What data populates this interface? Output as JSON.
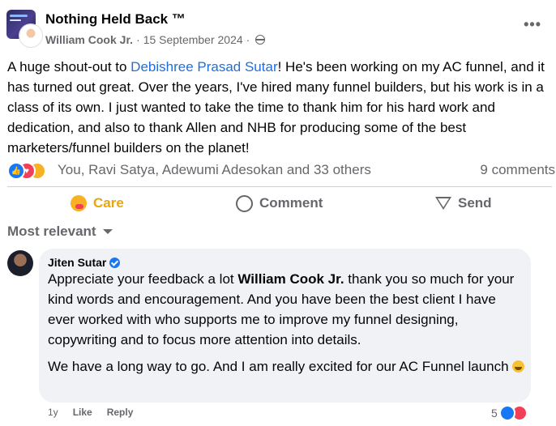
{
  "post": {
    "group_name": "Nothing Held Back ™",
    "author": "William Cook Jr.",
    "separator": " · ",
    "date": "15 September 2024",
    "text_before": "A huge shout-out to ",
    "mention": "Debishree Prasad Sutar",
    "text_after": "! He's been working on my AC funnel, and it has turned out great. Over the years, I've hired many funnel builders, but his work is in a class of its own. I just wanted to take the time to thank him for his hard work and dedication, and also to thank Allen and NHB for producing some of the best marketers/funnel builders on the planet!",
    "reaction_names": "You, Ravi Satya, Adewumi Adesokan and 33 others",
    "comments_count": "9 comments"
  },
  "actions": {
    "care": "Care",
    "comment": "Comment",
    "send": "Send"
  },
  "sort_label": "Most relevant",
  "comment": {
    "author": "Jiten Sutar",
    "p1_before": "Appreciate your feedback a lot ",
    "p1_bold": "William Cook Jr.",
    "p1_after": " thank you so much for your kind words and encouragement. And you have been the best client I have ever worked with who supports me to improve my funnel designing, copywriting and to focus more attention into details.",
    "p2": "We have a long way to go. And I am really excited for our AC Funnel launch ",
    "time": "1y",
    "like": "Like",
    "reply": "Reply",
    "reaction_count": "5"
  },
  "colors": {
    "link": "#216fdb",
    "like_blue": "#1877f2",
    "love_red": "#f33e58",
    "care_yellow": "#f7b125",
    "muted_text": "#65676b",
    "bubble_bg": "#f0f2f5"
  }
}
